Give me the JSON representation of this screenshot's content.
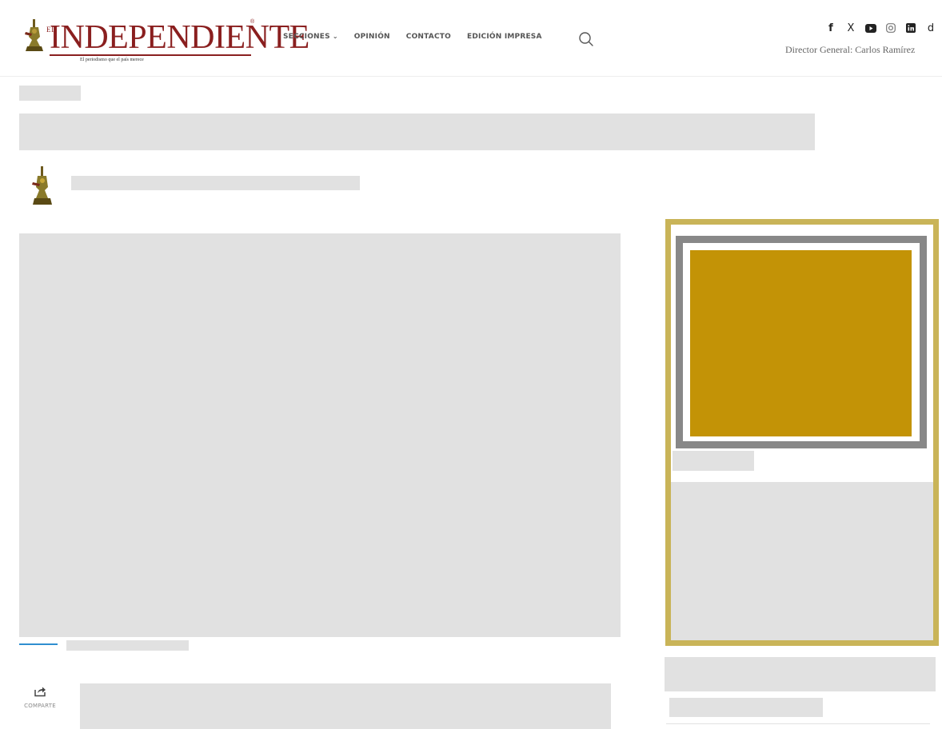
{
  "header": {
    "logo": {
      "el": "EL",
      "wordmark": "INDEPENDIENTE",
      "tagline": "El periodismo que el país merece",
      "registered": "®"
    },
    "nav": [
      {
        "label": "SECCIONES",
        "has_dropdown": true
      },
      {
        "label": "OPINIÓN"
      },
      {
        "label": "CONTACTO"
      },
      {
        "label": "EDICIÓN IMPRESA"
      }
    ],
    "search_icon": "search-icon",
    "social": [
      {
        "name": "facebook-icon",
        "glyph": "f"
      },
      {
        "name": "x-icon",
        "glyph": "X"
      },
      {
        "name": "youtube-icon",
        "glyph": ""
      },
      {
        "name": "instagram-icon",
        "glyph": ""
      },
      {
        "name": "linkedin-icon",
        "glyph": ""
      },
      {
        "name": "tiktok-icon",
        "glyph": "d"
      }
    ],
    "director": "Director General: Carlos Ramírez"
  },
  "article": {
    "share_label": "COMPARTE",
    "share_icon": "share-icon",
    "accent_color": "#2f8fd0"
  },
  "sidebar": {
    "ad_border_color": "#c9b458",
    "ad_inner_border_color": "#888888",
    "ad_fill_color": "#c39306"
  },
  "skeleton_color": "#e1e1e1"
}
